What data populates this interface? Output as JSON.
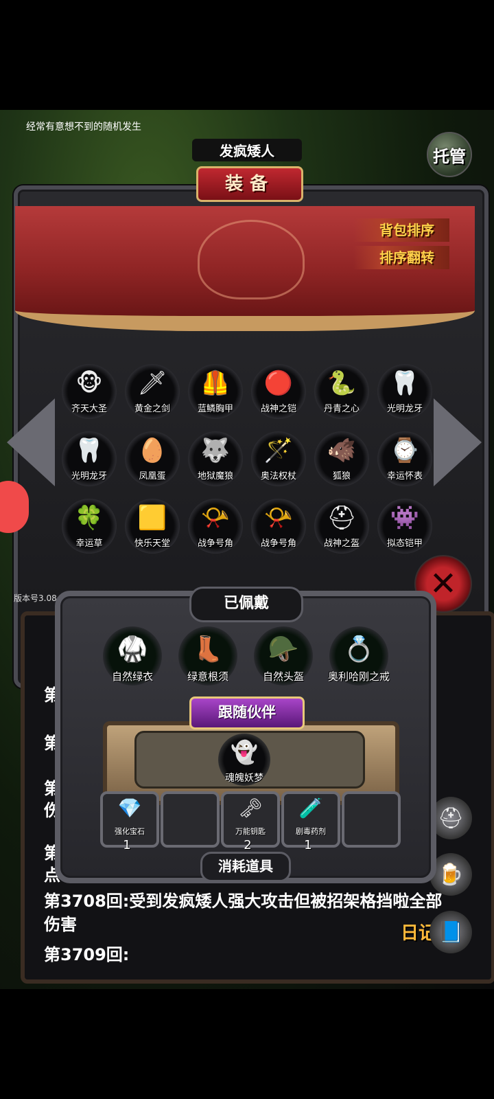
{
  "tip": "经常有意想不到的随机发生",
  "hero_name": "发疯矮人",
  "tuoguan": "托管",
  "panel_title": "装备",
  "banner_buttons": {
    "sort": "背包排序",
    "reverse": "排序翻转"
  },
  "bag_items": [
    {
      "name": "齐天大圣",
      "icon": "monkey-king-icon",
      "glyph": "🐵"
    },
    {
      "name": "黄金之剑",
      "icon": "golden-sword-icon",
      "glyph": "🗡"
    },
    {
      "name": "蓝鳞胸甲",
      "icon": "blue-armor-icon",
      "glyph": "🦺"
    },
    {
      "name": "战神之铠",
      "icon": "war-god-armor-icon",
      "glyph": "🔴"
    },
    {
      "name": "丹青之心",
      "icon": "danqing-heart-icon",
      "glyph": "🐍"
    },
    {
      "name": "光明龙牙",
      "icon": "dragon-fang-icon",
      "glyph": "🦷"
    },
    {
      "name": "光明龙牙",
      "icon": "dragon-fang-icon",
      "glyph": "🦷"
    },
    {
      "name": "凤凰蛋",
      "icon": "phoenix-egg-icon",
      "glyph": "🥚"
    },
    {
      "name": "地狱魔狼",
      "icon": "hell-wolf-icon",
      "glyph": "🐺"
    },
    {
      "name": "奥法权杖",
      "icon": "arcane-staff-icon",
      "glyph": "🪄"
    },
    {
      "name": "狐狼",
      "icon": "jackal-icon",
      "glyph": "🐗"
    },
    {
      "name": "幸运怀表",
      "icon": "lucky-watch-icon",
      "glyph": "⌚"
    },
    {
      "name": "幸运草",
      "icon": "clover-icon",
      "glyph": "🍀"
    },
    {
      "name": "快乐天堂",
      "icon": "gold-block-icon",
      "glyph": "🟨"
    },
    {
      "name": "战争号角",
      "icon": "war-horn-icon",
      "glyph": "📯"
    },
    {
      "name": "战争号角",
      "icon": "war-horn-icon",
      "glyph": "📯"
    },
    {
      "name": "战神之盔",
      "icon": "war-god-helmet-icon",
      "glyph": "⛑"
    },
    {
      "name": "拟态铠甲",
      "icon": "mimic-armor-icon",
      "glyph": "👾"
    }
  ],
  "version": "版本号3.08",
  "log_lines": [
    "第",
    "第",
    "第",
    "伤",
    "第",
    "点",
    "第3708回:受到发疯矮人强大攻击但被招架格挡啦全部",
    "伤害",
    "第3709回:"
  ],
  "diary": "日记",
  "worn_title": "已佩戴",
  "worn_items": [
    {
      "name": "自然绿衣",
      "glyph": "🥋"
    },
    {
      "name": "绿意根须",
      "glyph": "👢"
    },
    {
      "name": "自然头盔",
      "glyph": "🪖"
    },
    {
      "name": "奥利哈刚之戒",
      "glyph": "💍"
    }
  ],
  "companion_title": "跟随伙伴",
  "companion": {
    "name": "魂魄妖梦",
    "glyph": "👻"
  },
  "consumables": [
    {
      "name": "强化宝石",
      "glyph": "💎",
      "count": "1"
    },
    {
      "name": "",
      "glyph": "",
      "count": ""
    },
    {
      "name": "万能钥匙",
      "glyph": "🗝",
      "count": "2"
    },
    {
      "name": "剧毒药剂",
      "glyph": "🧪",
      "count": "1"
    },
    {
      "name": "",
      "glyph": "",
      "count": ""
    }
  ],
  "consumables_title": "消耗道具",
  "colors": {
    "accent_red": "#c02830",
    "gold": "#ffd24a",
    "diary": "#ffb93a"
  }
}
